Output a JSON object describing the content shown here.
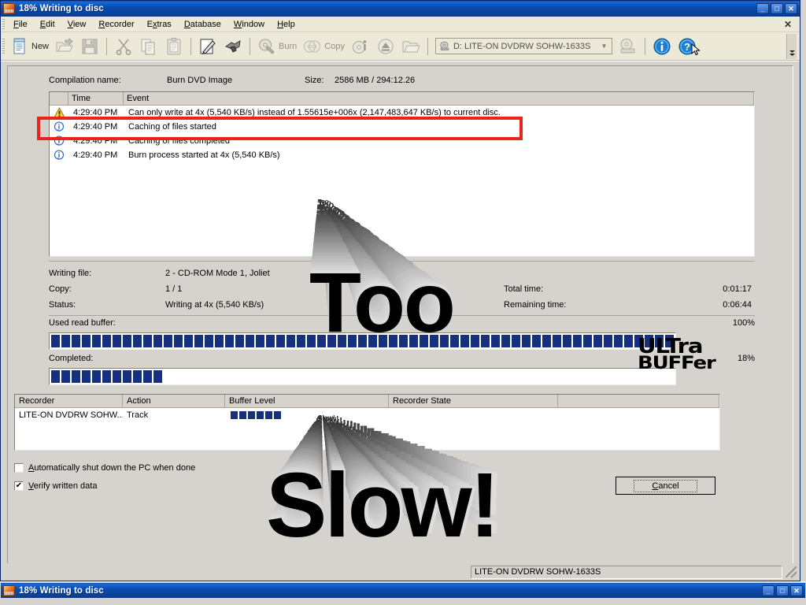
{
  "window": {
    "title": "18% Writing to disc",
    "icon": "nero-burning-rom-icon",
    "minimize": "_",
    "maximize": "□",
    "close": "✕"
  },
  "menubar": {
    "items": [
      {
        "label": "File",
        "accel": "F"
      },
      {
        "label": "Edit",
        "accel": "E"
      },
      {
        "label": "View",
        "accel": "V"
      },
      {
        "label": "Recorder",
        "accel": "R"
      },
      {
        "label": "Extras",
        "accel": "x"
      },
      {
        "label": "Database",
        "accel": "D"
      },
      {
        "label": "Window",
        "accel": "W"
      },
      {
        "label": "Help",
        "accel": "H"
      }
    ],
    "close_document": "✕"
  },
  "toolbar": {
    "new_label": "New",
    "burn_label": "Burn",
    "copy_label": "Copy",
    "drive_value": "D: LITE-ON DVDRW SOHW-1633S",
    "drive_arrow": "▼",
    "overflow": "»"
  },
  "compilation": {
    "name_label": "Compilation name:",
    "name_value": "Burn DVD Image",
    "size_label": "Size:",
    "size_value": "2586 MB  /  294:12.26"
  },
  "log": {
    "columns": [
      "",
      "Time",
      "Event"
    ],
    "rows": [
      {
        "icon": "warning-icon",
        "time": "4:29:40 PM",
        "event": "Can only write at 4x (5,540 KB/s) instead of 1.55615e+006x (2,147,483,647 KB/s) to current disc."
      },
      {
        "icon": "info-icon",
        "time": "4:29:40 PM",
        "event": "Caching of files started"
      },
      {
        "icon": "info-icon",
        "time": "4:29:40 PM",
        "event": "Caching of files completed"
      },
      {
        "icon": "info-icon",
        "time": "4:29:40 PM",
        "event": "Burn process started at 4x (5,540 KB/s)"
      }
    ]
  },
  "status": {
    "writing_file_label": "Writing file:",
    "writing_file_value": "2 - CD-ROM Mode 1, Joliet",
    "copy_label": "Copy:",
    "copy_value": "1 / 1",
    "status_label": "Status:",
    "status_value": "Writing at 4x (5,540 KB/s)",
    "total_time_label": "Total time:",
    "total_time_value": "0:01:17",
    "remaining_time_label": "Remaining time:",
    "remaining_time_value": "0:06:44"
  },
  "progress": {
    "read_buffer_label": "Used read buffer:",
    "read_buffer_percent": "100%",
    "read_buffer_value": 100,
    "completed_label": "Completed:",
    "completed_percent": "18%",
    "completed_value": 18,
    "logo_line1": "ULTra",
    "logo_line2": "BUFFer"
  },
  "recorder_table": {
    "columns": [
      "Recorder",
      "Action",
      "Buffer Level",
      "Recorder State",
      ""
    ],
    "rows": [
      {
        "recorder": "LITE-ON DVDRW SOHW...",
        "action": "Track",
        "buffer_segments": 6,
        "state": ""
      }
    ]
  },
  "options": {
    "shutdown_label": "Automatically shut down the PC when done",
    "shutdown_checked": false,
    "verify_label": "Verify written data",
    "verify_checked": true,
    "checkmark": "✔"
  },
  "buttons": {
    "cancel": "Cancel"
  },
  "statusbar": {
    "drive_text": "LITE-ON  DVDRW SOHW-1633S"
  },
  "watermark": {
    "line1": "Too",
    "line2": "Slow!",
    "color": "#000000"
  },
  "annotation": {
    "highlight_color": "#e8241b"
  },
  "taskbar": {
    "title": "18% Writing to disc",
    "minimize": "_",
    "maximize": "□",
    "close": "✕"
  }
}
